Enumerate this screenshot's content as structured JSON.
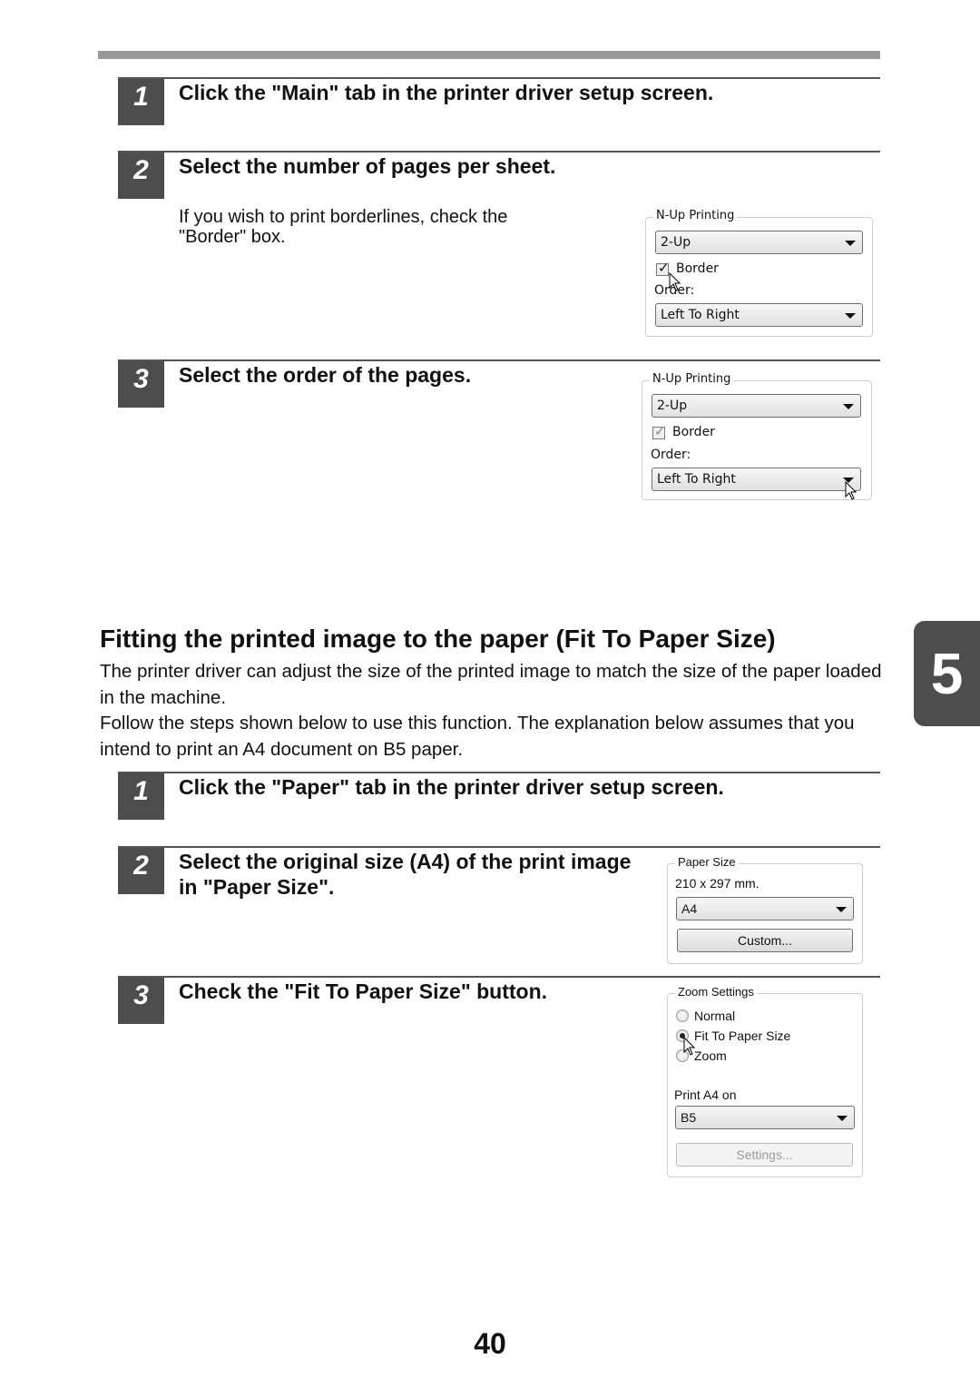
{
  "section1": {
    "steps": [
      {
        "number": "1",
        "title": "Click the \"Main\" tab in the printer driver setup screen."
      },
      {
        "number": "2",
        "title": "Select the number of pages per sheet.",
        "description": "If you wish to print borderlines, check the \"Border\" box."
      },
      {
        "number": "3",
        "title": "Select the order of the pages."
      }
    ],
    "nup_panel_a": {
      "legend": "N-Up Printing",
      "pages_value": "2-Up",
      "border_label": "Border",
      "border_checked": true,
      "order_label": "Order:",
      "order_value": "Left To Right"
    },
    "nup_panel_b": {
      "legend": "N-Up Printing",
      "pages_value": "2-Up",
      "border_label": "Border",
      "border_checked": true,
      "order_label": "Order:",
      "order_value": "Left To Right"
    }
  },
  "section2": {
    "heading": "Fitting the printed image to the paper (Fit To Paper Size)",
    "paragraphs": [
      "The printer driver can adjust the size of the printed image to match the size of the paper loaded in the machine.",
      "Follow the steps shown below to use this function. The explanation below assumes that you intend to print an A4 document on B5 paper."
    ],
    "steps": [
      {
        "number": "1",
        "title": "Click the \"Paper\" tab in the printer driver setup screen."
      },
      {
        "number": "2",
        "title": "Select the original size (A4) of the print image in \"Paper Size\"."
      },
      {
        "number": "3",
        "title": "Check the \"Fit To Paper Size\" button."
      }
    ],
    "paper_size_panel": {
      "legend": "Paper Size",
      "dimensions": "210 x 297 mm.",
      "value": "A4",
      "custom_button": "Custom..."
    },
    "zoom_panel": {
      "legend": "Zoom Settings",
      "options": [
        "Normal",
        "Fit To Paper Size",
        "Zoom"
      ],
      "selected": "Fit To Paper Size",
      "print_on_label": "Print A4 on",
      "print_on_value": "B5",
      "settings_button": "Settings..."
    }
  },
  "chapter_tab": "5",
  "page_number": "40"
}
